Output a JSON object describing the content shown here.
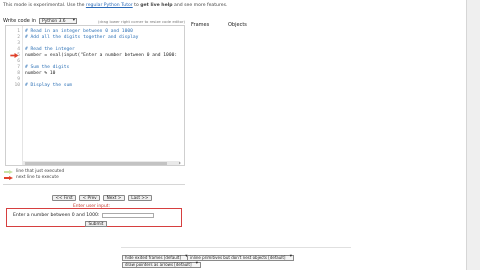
{
  "banner": {
    "prefix": "This mode is experimental. Use the ",
    "link": "regular Python Tutor",
    "middle": " to ",
    "bold": "get live help",
    "suffix": " and see more features."
  },
  "editor_header": {
    "label": "Write code in",
    "language": "Python 3.6",
    "resize_hint": "(drag lower right corner to resize code editor)"
  },
  "code_lines": [
    {
      "num": "1",
      "text": "# Read in an integer between 0 and 1000",
      "comment": true
    },
    {
      "num": "2",
      "text": "#  Add all the digits together and display",
      "comment": true
    },
    {
      "num": "3",
      "text": "",
      "comment": false
    },
    {
      "num": "4",
      "text": "# Read the integer",
      "comment": true
    },
    {
      "num": "5",
      "text": "number = eval(input(\"Enter a number between 0 and 1000:",
      "comment": false
    },
    {
      "num": "6",
      "text": "",
      "comment": false
    },
    {
      "num": "7",
      "text": "# Sum the digits",
      "comment": true
    },
    {
      "num": "8",
      "text": "number % 10",
      "comment": false
    },
    {
      "num": "9",
      "text": "",
      "comment": false
    },
    {
      "num": "10",
      "text": "# Display the sum",
      "comment": true
    }
  ],
  "current_line": "5",
  "visualizer": {
    "frames_label": "Frames",
    "objects_label": "Objects"
  },
  "legend": {
    "executed": "line that just executed",
    "next": "next line to execute",
    "executed_color": "#c8e3a6",
    "next_color": "#e0402a"
  },
  "nav": {
    "first": "<< First",
    "prev": "< Prev",
    "next": "Next >",
    "last": "Last >>"
  },
  "user_input": {
    "title": "Enter user input:",
    "prompt": "Enter a number between 0 and 1000:",
    "submit": "Submit"
  },
  "options": {
    "frames": "hide exited frames [default]",
    "primitives": "inline primitives but don't nest objects [default]",
    "pointers": "draw pointers as arrows [default]"
  }
}
